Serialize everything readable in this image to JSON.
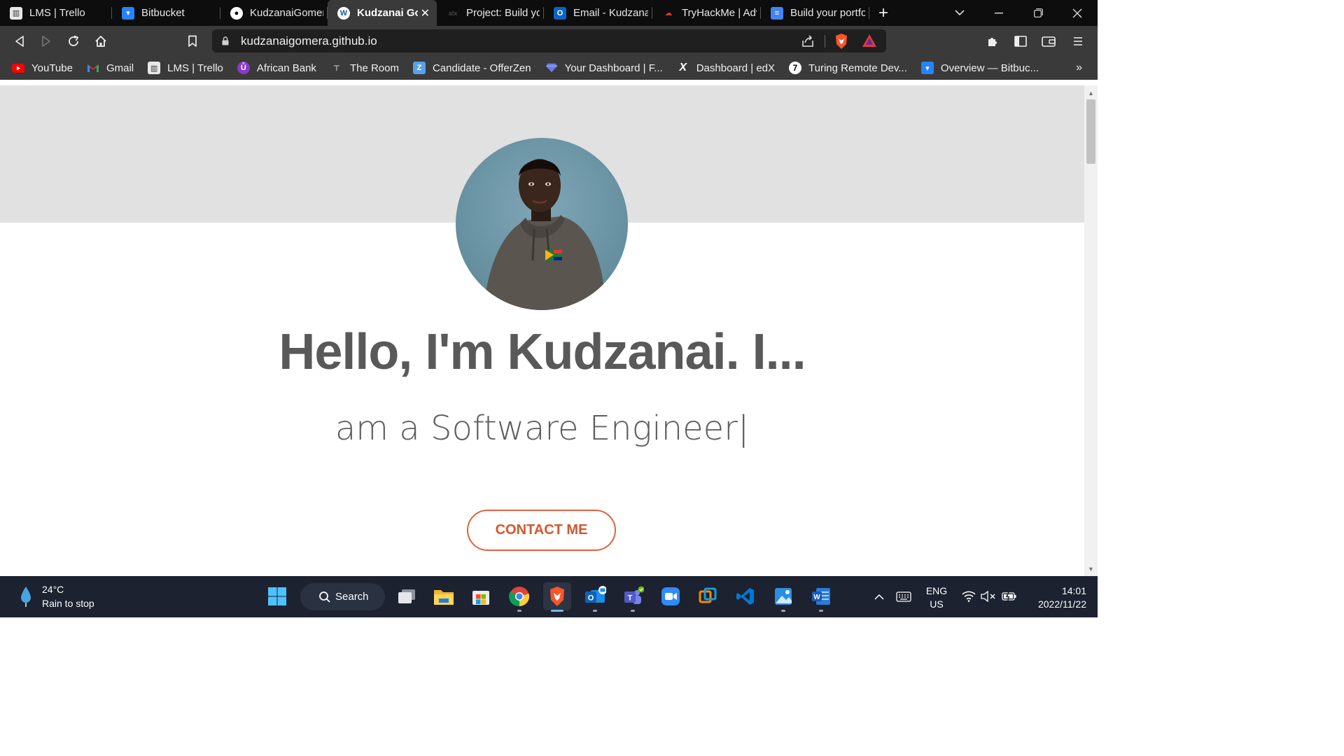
{
  "browser": {
    "tabs": [
      {
        "title": "LMS | Trello",
        "active": false
      },
      {
        "title": "Bitbucket",
        "active": false
      },
      {
        "title": "KudzanaiGomera",
        "active": false
      },
      {
        "title": "Kudzanai Go",
        "active": true
      },
      {
        "title": "Project: Build you",
        "active": false
      },
      {
        "title": "Email - Kudzanai",
        "active": false
      },
      {
        "title": "TryHackMe | Adv",
        "active": false
      },
      {
        "title": "Build your portfo",
        "active": false
      }
    ],
    "url": "kudzanaigomera.github.io",
    "bookmarks": [
      {
        "label": "YouTube"
      },
      {
        "label": "Gmail"
      },
      {
        "label": "LMS | Trello"
      },
      {
        "label": "African Bank"
      },
      {
        "label": "The Room"
      },
      {
        "label": "Candidate - OfferZen"
      },
      {
        "label": "Your Dashboard | F..."
      },
      {
        "label": "Dashboard | edX"
      },
      {
        "label": "Turing Remote Dev..."
      },
      {
        "label": "Overview — Bitbuc..."
      }
    ],
    "bookmarks_more": "»"
  },
  "page": {
    "headline": "Hello, I'm Kudzanai. I...",
    "subline": "am a Software Engineer|",
    "contact_label": "CONTACT ME",
    "accent_color": "#e0633e",
    "hero_band_color": "#e1e1e1"
  },
  "taskbar": {
    "weather": {
      "temp": "24°C",
      "condition": "Rain to stop"
    },
    "search_label": "Search",
    "language": {
      "line1": "ENG",
      "line2": "US"
    },
    "clock": {
      "time": "14:01",
      "date": "2022/11/22"
    }
  }
}
